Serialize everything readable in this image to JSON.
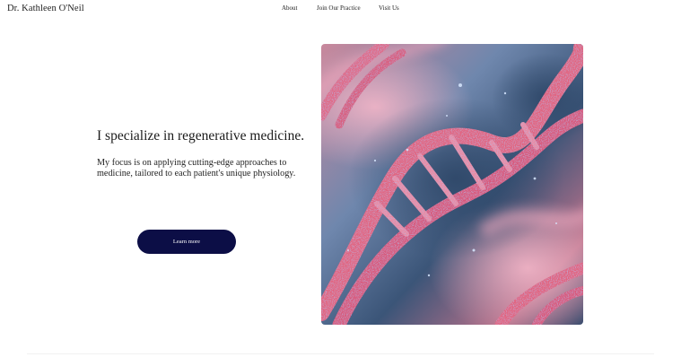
{
  "header": {
    "site_title": "Dr. Kathleen O'Neil",
    "nav": [
      "About",
      "Join Our Practice",
      "Visit Us"
    ]
  },
  "hero": {
    "headline": "I specialize in regenerative medicine.",
    "lead": "My focus is on applying cutting-edge approaches to medicine, tailored to each patient's unique physiology.",
    "cta_label": "Learn more",
    "image_subject": "dna-double-helix-illustration"
  },
  "colors": {
    "cta_background": "#0c0e46",
    "helix_pink": "#e2637e",
    "helix_blue": "#5a8fd6",
    "image_background": "#3d5a7c"
  }
}
